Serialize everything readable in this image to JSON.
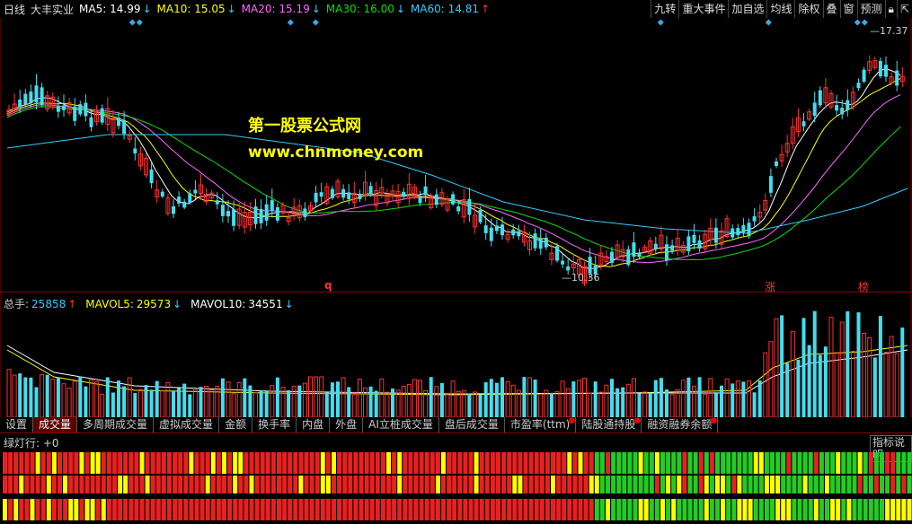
{
  "header": {
    "period": "日线",
    "stock": "大丰实业",
    "ma": [
      {
        "label": "MA5:",
        "value": "14.99",
        "arrow": "↓",
        "color": "#ffffff"
      },
      {
        "label": "MA10:",
        "value": "15.05",
        "arrow": "↓",
        "color": "#ffff00"
      },
      {
        "label": "MA20:",
        "value": "15.19",
        "arrow": "↓",
        "color": "#ff66ff"
      },
      {
        "label": "MA30:",
        "value": "16.00",
        "arrow": "↓",
        "color": "#00e000"
      },
      {
        "label": "MA60:",
        "value": "14.81",
        "arrow": "↑",
        "color": "#33ccff"
      }
    ],
    "buttons": [
      "九转",
      "重大事件",
      "加自选",
      "均线",
      "除权",
      "叠",
      "窗",
      "预测"
    ]
  },
  "overlay": {
    "line1": "第一股票公式网",
    "line2": "www.chnmoney.com"
  },
  "price_labels": {
    "high": "17.37",
    "low": "10.36"
  },
  "markers": {
    "q": "q",
    "zhang": "涨",
    "bang": "榜"
  },
  "volume_header": {
    "total_label": "总手:",
    "total_value": "25858",
    "total_arrow": "↑",
    "mavol5_label": "MAVOL5:",
    "mavol5_value": "29573",
    "mavol5_arrow": "↓",
    "mavol10_label": "MAVOL10:",
    "mavol10_value": "34551",
    "mavol10_arrow": "↓"
  },
  "tabs": [
    {
      "label": "设置"
    },
    {
      "label": "成交量",
      "active": true
    },
    {
      "label": "多周期成交量"
    },
    {
      "label": "虚拟成交量"
    },
    {
      "label": "金额"
    },
    {
      "label": "换手率"
    },
    {
      "label": "内盘"
    },
    {
      "label": "外盘"
    },
    {
      "label": "AI立桩成交量"
    },
    {
      "label": "盘后成交量"
    },
    {
      "label": "市盈率(ttm)",
      "dot": true
    },
    {
      "label": "陆股通持股",
      "dot": true
    },
    {
      "label": "融资融券余额",
      "dot": true
    }
  ],
  "indicator": {
    "label": "绿灯行: +0",
    "help": "指标说明"
  },
  "colors": {
    "up": "#ff3030",
    "down": "#44ddee",
    "bg": "#000000",
    "grid": "#8b0000"
  }
}
